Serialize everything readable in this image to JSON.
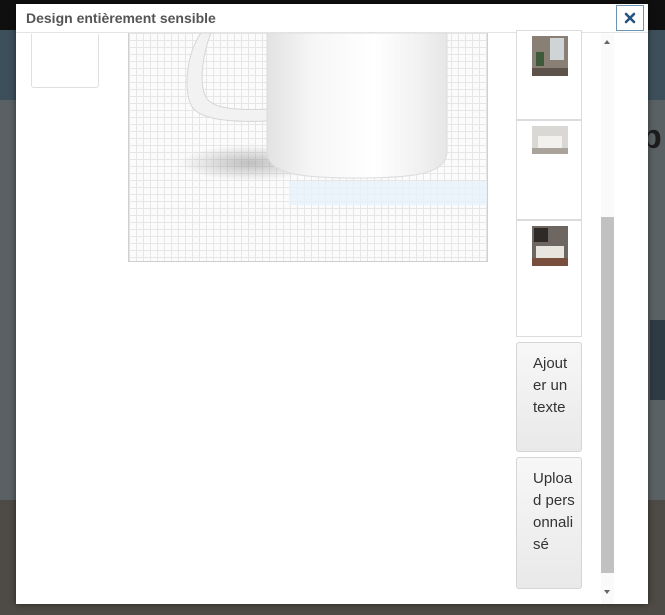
{
  "dialog": {
    "title": "Design entièrement sensible",
    "close_icon": "close-icon"
  },
  "sidebar": {
    "items": [
      {
        "icon": "room-photo-thumbnail"
      },
      {
        "icon": "bedroom-photo-thumbnail"
      },
      {
        "icon": "living-room-photo-thumbnail"
      }
    ],
    "add_text_label": "Ajouter un texte",
    "upload_label": "Upload personnalisé"
  },
  "colors": {
    "close_border": "#6f93b3",
    "scrollbar_thumb": "#c1c1c1",
    "canvas_grid": "#e6e6e6"
  }
}
